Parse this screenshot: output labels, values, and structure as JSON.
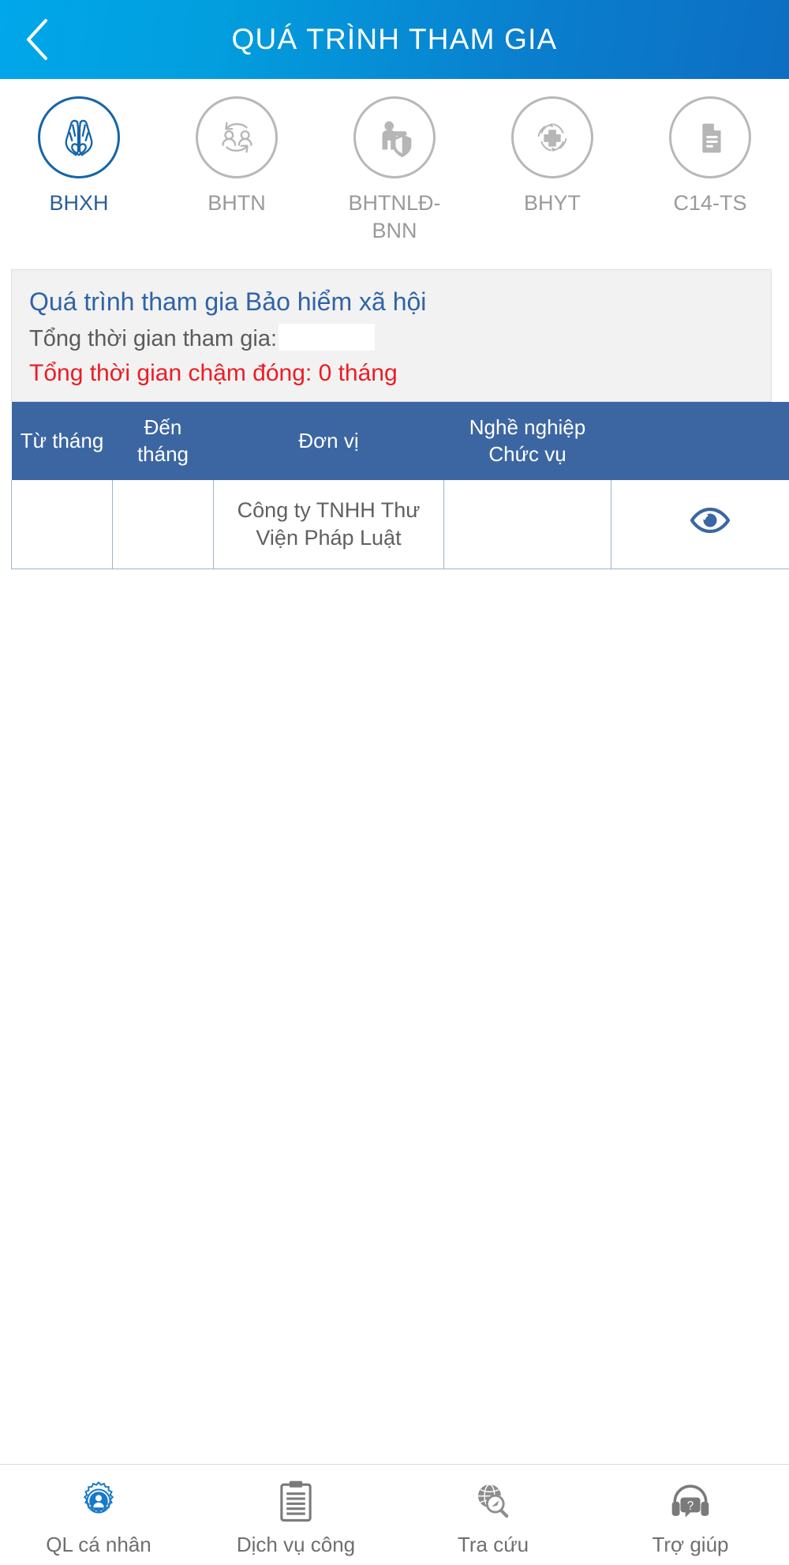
{
  "header": {
    "title": "QUÁ TRÌNH THAM GIA",
    "back_icon": "chevron-left-icon",
    "gradient_from": "#00a7ea",
    "gradient_to": "#0d6ec2"
  },
  "tabs": {
    "active_index": 0,
    "active_color": "#2b5c9c",
    "inactive_color": "#9a9a9a",
    "items": [
      {
        "label": "BHXH",
        "icon": "praying-hands-heart-icon"
      },
      {
        "label": "BHTN",
        "icon": "people-exchange-icon"
      },
      {
        "label": "BHTNLĐ-BNN",
        "icon": "worker-shield-icon"
      },
      {
        "label": "BHYT",
        "icon": "medical-cross-refresh-icon"
      },
      {
        "label": "C14-TS",
        "icon": "document-lines-icon"
      }
    ]
  },
  "summary": {
    "title": "Quá trình tham gia Bảo hiểm xã hội",
    "total_time_label": "Tổng thời gian tham gia:",
    "total_time_value": "",
    "late_payment_text": "Tổng thời gian chậm đóng: 0 tháng",
    "late_payment_color": "#ec1c24",
    "title_color": "#2f63a6"
  },
  "table": {
    "header_color": "#3b66a2",
    "columns": [
      "Từ tháng",
      "Đến tháng",
      "Đơn vị",
      "Nghề nghiệp Chức vụ",
      ""
    ],
    "rows": [
      {
        "from_month": "",
        "to_month": "",
        "unit": "Công ty TNHH Thư Viện Pháp Luật",
        "job": "",
        "action_icon": "eye-icon"
      }
    ]
  },
  "bottom_nav": {
    "items": [
      {
        "label": "QL cá nhân",
        "icon": "gear-person-icon",
        "active": true
      },
      {
        "label": "Dịch vụ công",
        "icon": "clipboard-icon",
        "active": false
      },
      {
        "label": "Tra cứu",
        "icon": "globe-search-icon",
        "active": false
      },
      {
        "label": "Trợ giúp",
        "icon": "headset-help-icon",
        "active": false
      }
    ]
  }
}
